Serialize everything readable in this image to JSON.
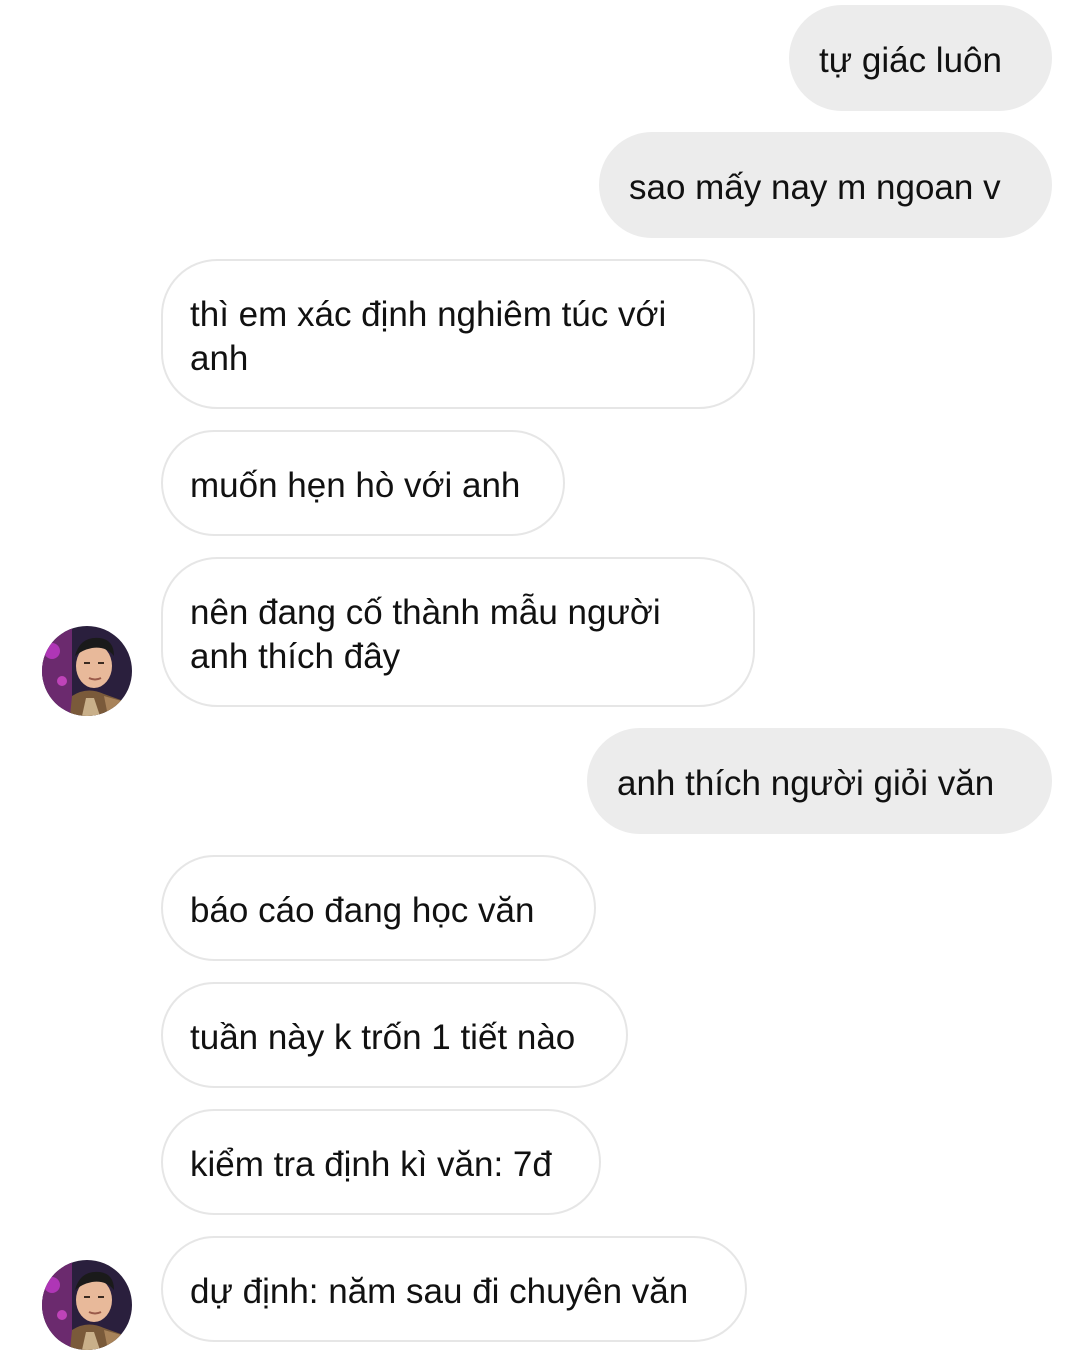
{
  "messages": [
    {
      "id": 1,
      "direction": "outgoing",
      "text": "tự giác luôn"
    },
    {
      "id": 2,
      "direction": "outgoing",
      "text": "sao mấy nay m ngoan v"
    },
    {
      "id": 3,
      "direction": "incoming",
      "text": "thì em xác định nghiêm túc với anh"
    },
    {
      "id": 4,
      "direction": "incoming",
      "text": "muốn hẹn hò với anh"
    },
    {
      "id": 5,
      "direction": "incoming",
      "text": "nên đang cố thành mẫu người anh thích đây"
    },
    {
      "id": 6,
      "direction": "outgoing",
      "text": "anh thích người giỏi văn"
    },
    {
      "id": 7,
      "direction": "incoming",
      "text": "báo cáo đang học văn"
    },
    {
      "id": 8,
      "direction": "incoming",
      "text": "tuần này k trốn 1 tiết nào"
    },
    {
      "id": 9,
      "direction": "incoming",
      "text": "kiểm tra định kì văn: 7đ"
    },
    {
      "id": 10,
      "direction": "incoming",
      "text": "dự định: năm sau đi chuyên văn"
    }
  ],
  "colors": {
    "outgoing_bubble": "#ececec",
    "incoming_border": "#e6e6e6",
    "text": "#111111"
  },
  "icons": {
    "avatar": "contact-avatar-photo"
  }
}
